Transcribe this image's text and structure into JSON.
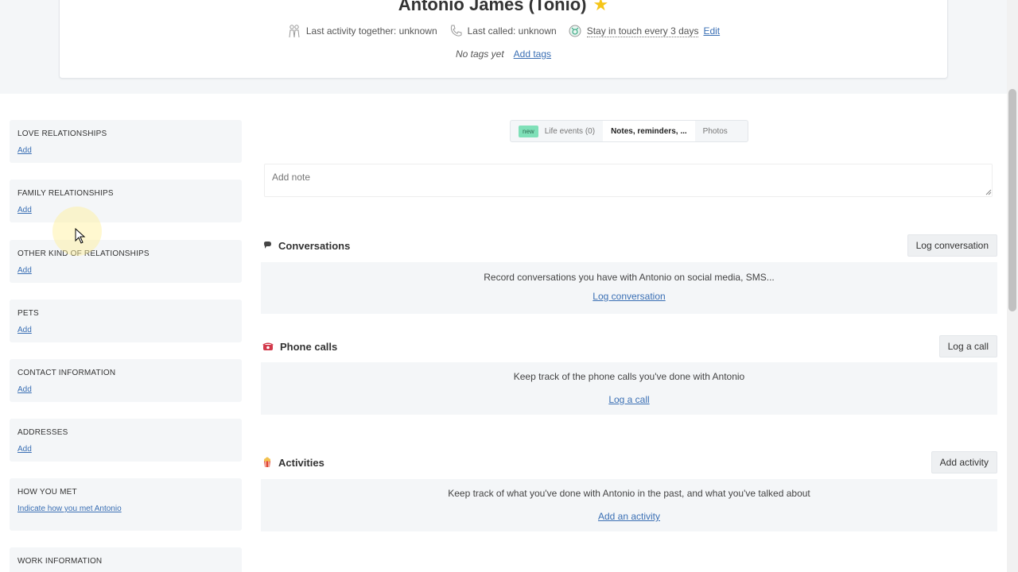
{
  "header": {
    "name": "Antonio James (Tonio)",
    "star": "★",
    "last_activity": "Last activity together: unknown",
    "last_called": "Last called: unknown",
    "stay_in_touch": "Stay in touch every 3 days",
    "edit_label": "Edit",
    "no_tags": "No tags yet",
    "add_tags": "Add tags"
  },
  "sidebar": {
    "items": [
      {
        "title": "Love relationships",
        "action": "Add"
      },
      {
        "title": "Family relationships",
        "action": "Add"
      },
      {
        "title": "Other kind of relationships",
        "action": "Add"
      },
      {
        "title": "Pets",
        "action": "Add"
      },
      {
        "title": "Contact information",
        "action": "Add"
      },
      {
        "title": "Addresses",
        "action": "Add"
      },
      {
        "title": "How you met",
        "action": "Indicate how you met Antonio"
      },
      {
        "title": "Work information",
        "action": ""
      }
    ]
  },
  "tabs": {
    "new_badge": "new",
    "life_events": "Life events (0)",
    "notes": "Notes, reminders, ...",
    "photos": "Photos"
  },
  "note": {
    "placeholder": "Add note"
  },
  "conversations": {
    "title": "Conversations",
    "button": "Log conversation",
    "description": "Record conversations you have with Antonio on social media, SMS...",
    "link": "Log conversation"
  },
  "phone_calls": {
    "title": "Phone calls",
    "button": "Log a call",
    "description": "Keep track of the phone calls you've done with Antonio",
    "link": "Log a call"
  },
  "activities": {
    "title": "Activities",
    "button": "Add activity",
    "description": "Keep track of what you've done with Antonio in the past, and what you've talked about",
    "link": "Add an activity"
  },
  "colors": {
    "accent_link": "#3a6fb4",
    "new_badge": "#7fe0b8",
    "star": "#f5c518",
    "panel_bg": "#f4f6f8"
  }
}
